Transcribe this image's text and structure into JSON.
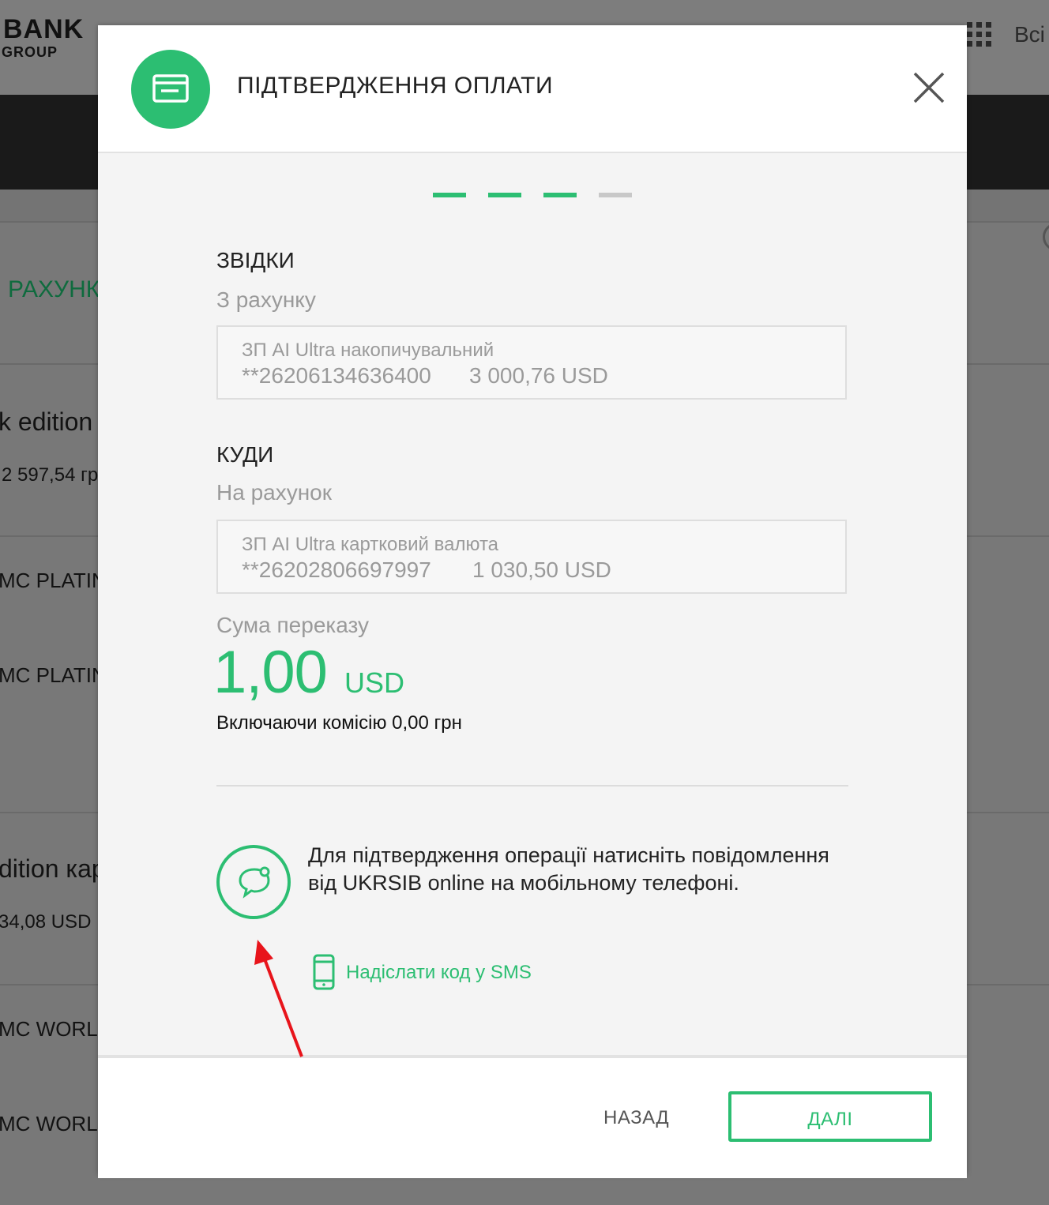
{
  "background": {
    "logo_bank": "BANK",
    "logo_group": "GROUP",
    "all_label": "Всі",
    "tab_label": "РАХУНК",
    "rows": [
      {
        "title": "k edition",
        "sub": "2 597,54 гр"
      },
      {
        "title": "MC PLATIN"
      },
      {
        "title": "MC PLATIN"
      },
      {
        "title": "dition кар",
        "sub": "34,08 USD"
      },
      {
        "title": "MC WORL"
      },
      {
        "title": "MC WORL"
      }
    ]
  },
  "modal": {
    "title": "ПІДТВЕРДЖЕННЯ ОПЛАТИ",
    "header_icon": "payment-card-icon",
    "close_icon": "close-icon",
    "steps": {
      "total": 4,
      "completed": 3
    },
    "from": {
      "label": "ЗВІДКИ",
      "sub": "З рахунку",
      "account_name": "ЗП AI Ultra накопичувальний",
      "account_number": "**26206134636400",
      "balance": "3 000,76 USD"
    },
    "to": {
      "label": "КУДИ",
      "sub": "На рахунок",
      "account_name": "ЗП AI Ultra картковий валюта",
      "account_number": "**26202806697997",
      "balance": "1 030,50 USD"
    },
    "amount": {
      "label": "Сума переказу",
      "value": "1,00",
      "currency": "USD",
      "commission": "Включаючи комісію 0,00 грн"
    },
    "push": {
      "icon": "chat-bubble-icon",
      "text": "Для підтвердження операції натисніть повідомлення від UKRSIB online на мобільному телефоні."
    },
    "sms": {
      "icon": "mobile-phone-icon",
      "label": "Надіслати код у SMS"
    },
    "footer": {
      "back_label": "НАЗАД",
      "next_label": "ДАЛІ"
    }
  },
  "colors": {
    "accent": "#2cbe72",
    "step_inactive": "#c8c8c8",
    "annotation_arrow": "#e8141b"
  }
}
